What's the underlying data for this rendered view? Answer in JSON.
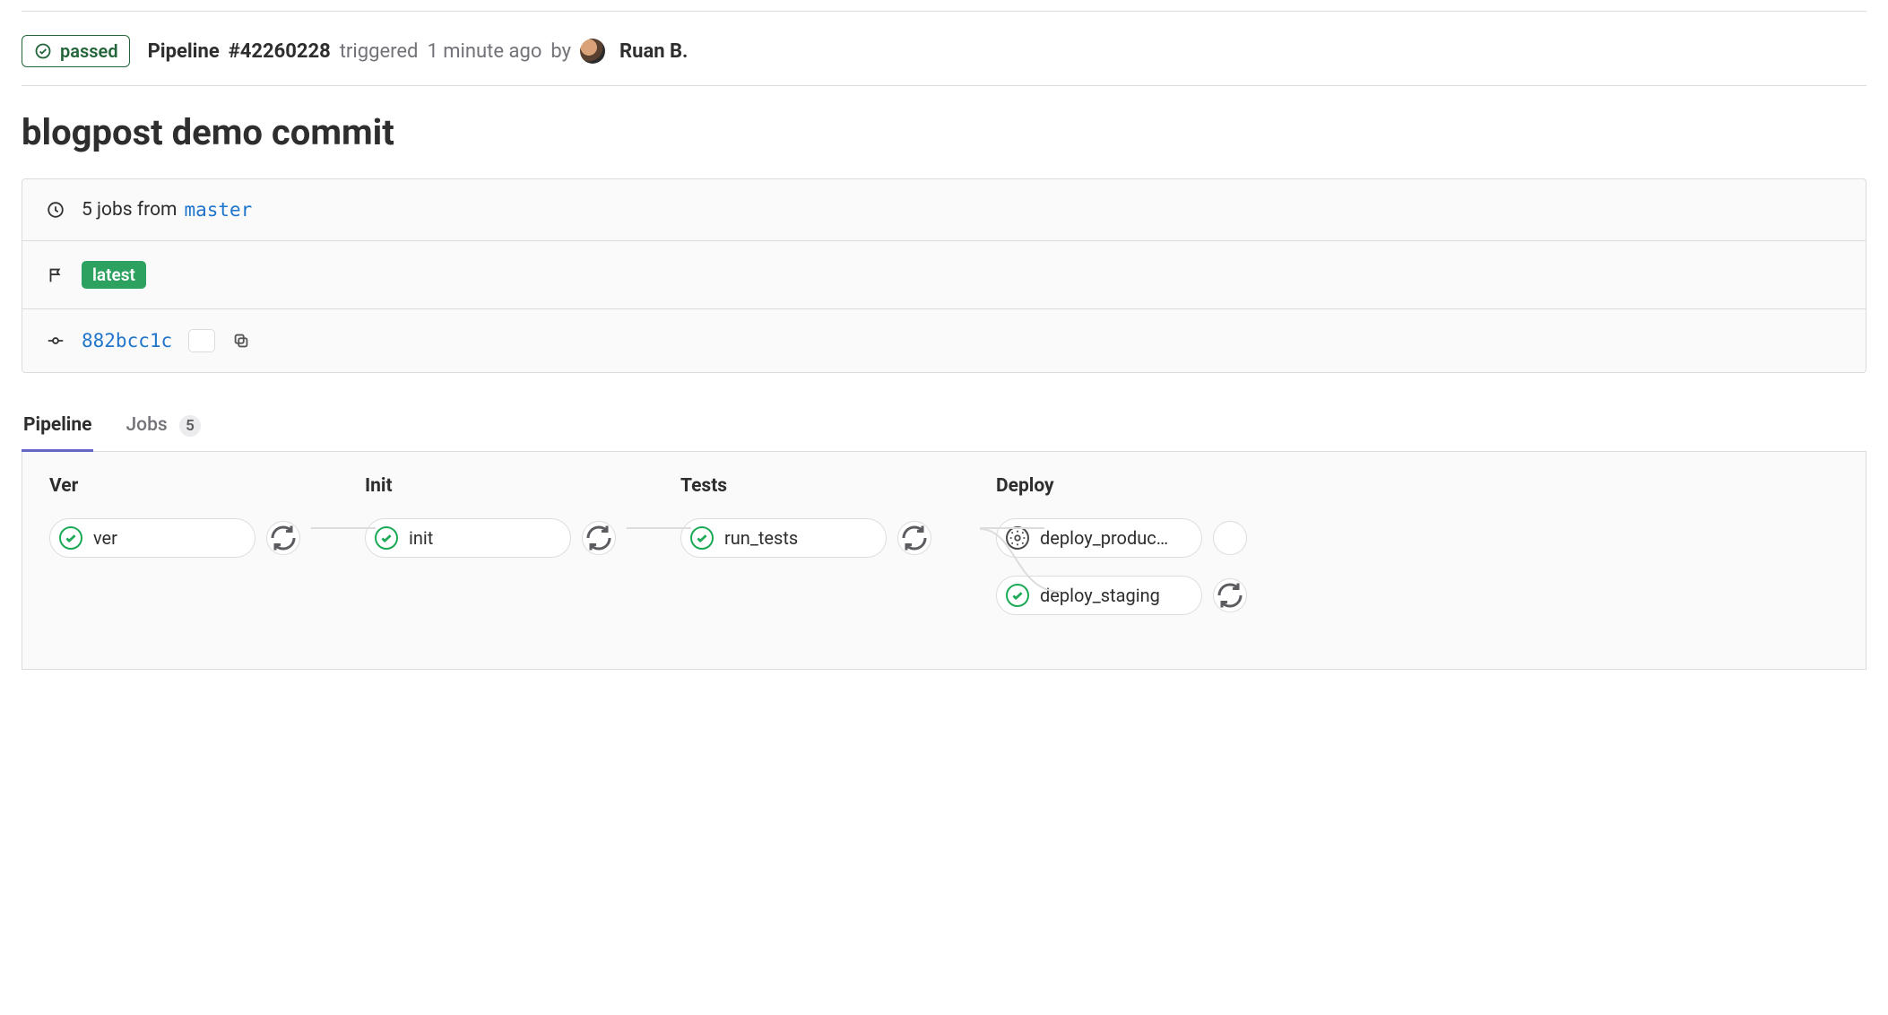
{
  "header": {
    "status_label": "passed",
    "pipeline_prefix": "Pipeline",
    "pipeline_id": "#42260228",
    "triggered_text": "triggered",
    "time_ago": "1 minute ago",
    "by_text": "by",
    "user_name": "Ruan B."
  },
  "commit_title": "blogpost demo commit",
  "info": {
    "jobs_count_text": "5 jobs from",
    "branch": "master",
    "tag_latest": "latest",
    "commit_sha": "882bcc1c"
  },
  "tabs": {
    "pipeline": "Pipeline",
    "jobs": "Jobs",
    "jobs_count": "5"
  },
  "stages": [
    {
      "title": "Ver",
      "jobs": [
        {
          "name": "ver",
          "status": "passed",
          "action": "retry"
        }
      ]
    },
    {
      "title": "Init",
      "jobs": [
        {
          "name": "init",
          "status": "passed",
          "action": "retry"
        }
      ]
    },
    {
      "title": "Tests",
      "jobs": [
        {
          "name": "run_tests",
          "status": "passed",
          "action": "retry"
        }
      ]
    },
    {
      "title": "Deploy",
      "jobs": [
        {
          "name": "deploy_produc…",
          "status": "manual",
          "action": "play"
        },
        {
          "name": "deploy_staging",
          "status": "passed",
          "action": "retry"
        }
      ]
    }
  ]
}
